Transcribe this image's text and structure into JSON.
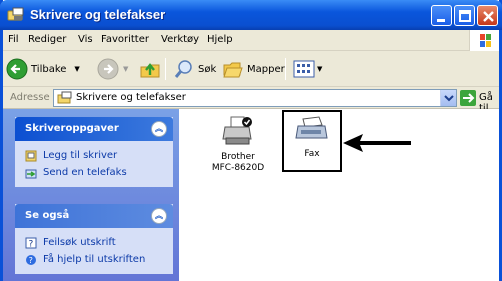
{
  "window": {
    "title": "Skrivere og telefakser"
  },
  "menubar": {
    "items": [
      "Fil",
      "Rediger",
      "Vis",
      "Favoritter",
      "Verktøy",
      "Hjelp"
    ]
  },
  "toolbar": {
    "back_label": "Tilbake",
    "search_label": "Søk",
    "folders_label": "Mapper"
  },
  "address": {
    "label": "Adresse",
    "value": "Skrivere og telefakser",
    "go_label": "Gå til"
  },
  "sidebar": {
    "printer_tasks": {
      "title": "Skriveroppgaver",
      "items": [
        "Legg til skriver",
        "Send en telefaks"
      ]
    },
    "see_also": {
      "title": "Se også",
      "items": [
        "Feilsøk utskrift",
        "Få hjelp til utskriften"
      ]
    }
  },
  "content": {
    "items": [
      {
        "label_line1": "Brother",
        "label_line2": "MFC-8620D"
      },
      {
        "label_line1": "Fax"
      }
    ]
  },
  "colors": {
    "titlebar": "#0a56dc",
    "sidebar": "#6f8fe0",
    "panel_head": "#0c4fd1",
    "link": "#0c3aa8"
  }
}
